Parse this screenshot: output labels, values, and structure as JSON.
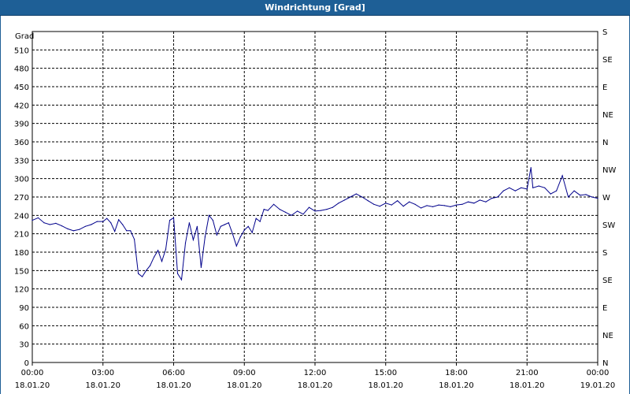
{
  "window": {
    "title": "Windrichtung [Grad]"
  },
  "colors": {
    "titlebar": "#1e5f96",
    "series": "#00008b",
    "grid": "#000000"
  },
  "chart_data": {
    "type": "line",
    "title": "Windrichtung [Grad]",
    "ylabel": "Grad",
    "ylim": [
      0,
      540
    ],
    "yticks": [
      0,
      30,
      60,
      90,
      120,
      150,
      180,
      210,
      240,
      270,
      300,
      330,
      360,
      390,
      420,
      450,
      480,
      510
    ],
    "y2ticks": [
      {
        "value": 0,
        "label": "N"
      },
      {
        "value": 45,
        "label": "NE"
      },
      {
        "value": 90,
        "label": "E"
      },
      {
        "value": 135,
        "label": "SE"
      },
      {
        "value": 180,
        "label": "S"
      },
      {
        "value": 225,
        "label": "SW"
      },
      {
        "value": 270,
        "label": "W"
      },
      {
        "value": 315,
        "label": "NW"
      },
      {
        "value": 360,
        "label": "N"
      },
      {
        "value": 405,
        "label": "NE"
      },
      {
        "value": 450,
        "label": "E"
      },
      {
        "value": 495,
        "label": "SE"
      },
      {
        "value": 540,
        "label": "S"
      }
    ],
    "xlim": [
      "18.01.20 00:00",
      "19.01.20 00:00"
    ],
    "xticks": [
      {
        "time": "00:00",
        "date": "18.01.20"
      },
      {
        "time": "03:00",
        "date": "18.01.20"
      },
      {
        "time": "06:00",
        "date": "18.01.20"
      },
      {
        "time": "09:00",
        "date": "18.01.20"
      },
      {
        "time": "12:00",
        "date": "18.01.20"
      },
      {
        "time": "15:00",
        "date": "18.01.20"
      },
      {
        "time": "18:00",
        "date": "18.01.20"
      },
      {
        "time": "21:00",
        "date": "18.01.20"
      },
      {
        "time": "00:00",
        "date": "19.01.20"
      }
    ],
    "grid": true,
    "series": [
      {
        "x": [
          "00:00",
          "00:15",
          "00:30",
          "00:45",
          "01:00",
          "01:15",
          "01:30",
          "01:45",
          "02:00",
          "02:15",
          "02:30",
          "02:45",
          "03:00",
          "03:10",
          "03:20",
          "03:30",
          "03:40",
          "03:50",
          "04:00",
          "04:10",
          "04:20",
          "04:30",
          "04:40",
          "04:50",
          "05:00",
          "05:10",
          "05:20",
          "05:30",
          "05:40",
          "05:50",
          "06:00",
          "06:10",
          "06:20",
          "06:30",
          "06:40",
          "06:50",
          "07:00",
          "07:10",
          "07:20",
          "07:30",
          "07:40",
          "07:50",
          "08:00",
          "08:10",
          "08:20",
          "08:30",
          "08:40",
          "08:50",
          "09:00",
          "09:10",
          "09:20",
          "09:30",
          "09:40",
          "09:50",
          "10:00",
          "10:15",
          "10:30",
          "10:45",
          "11:00",
          "11:15",
          "11:30",
          "11:45",
          "12:00",
          "12:15",
          "12:30",
          "12:45",
          "13:00",
          "13:15",
          "13:30",
          "13:45",
          "14:00",
          "14:15",
          "14:30",
          "14:45",
          "15:00",
          "15:15",
          "15:30",
          "15:45",
          "16:00",
          "16:15",
          "16:30",
          "16:45",
          "17:00",
          "17:15",
          "17:30",
          "17:45",
          "18:00",
          "18:15",
          "18:30",
          "18:45",
          "19:00",
          "19:15",
          "19:30",
          "19:45",
          "20:00",
          "20:15",
          "20:30",
          "20:45",
          "21:00",
          "21:10",
          "21:15",
          "21:30",
          "21:45",
          "22:00",
          "22:15",
          "22:30",
          "22:45",
          "23:00",
          "23:15",
          "23:30",
          "23:45",
          "24:00"
        ],
        "y": [
          232,
          236,
          228,
          225,
          227,
          223,
          218,
          215,
          217,
          222,
          225,
          230,
          230,
          235,
          228,
          214,
          233,
          225,
          215,
          215,
          201,
          145,
          140,
          150,
          158,
          172,
          183,
          165,
          185,
          232,
          236,
          145,
          135,
          195,
          228,
          200,
          222,
          155,
          205,
          240,
          232,
          208,
          222,
          225,
          228,
          210,
          190,
          205,
          216,
          222,
          212,
          235,
          230,
          250,
          248,
          258,
          250,
          245,
          240,
          247,
          242,
          253,
          247,
          248,
          250,
          253,
          260,
          265,
          270,
          275,
          270,
          264,
          258,
          255,
          260,
          257,
          264,
          255,
          262,
          258,
          252,
          256,
          254,
          257,
          256,
          254,
          257,
          258,
          262,
          260,
          265,
          262,
          268,
          270,
          280,
          285,
          280,
          285,
          283,
          318,
          285,
          288,
          285,
          275,
          280,
          305,
          270,
          280,
          273,
          274,
          270,
          268
        ]
      }
    ]
  }
}
